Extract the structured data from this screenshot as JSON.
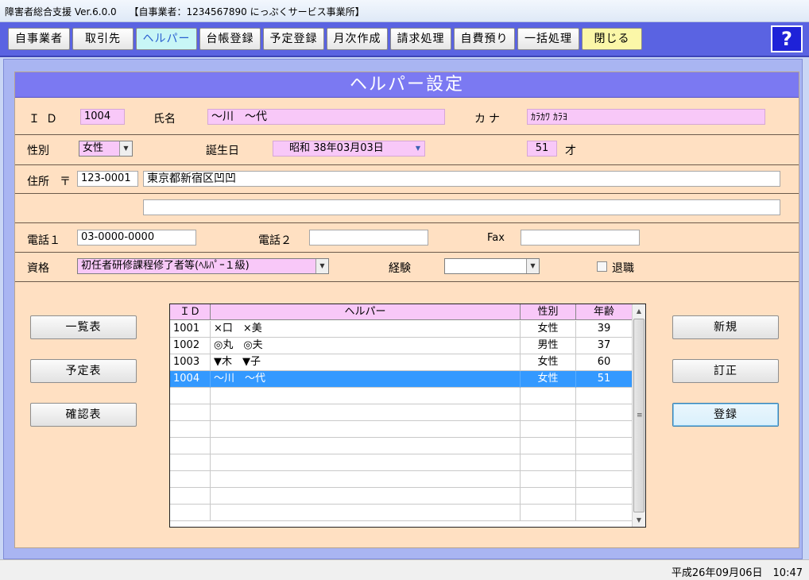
{
  "window": {
    "title": "障害者総合支援 Ver.6.0.0　 【自事業者：1234567890 にっぷくサービス事業所】"
  },
  "toolbar": {
    "items": [
      "自事業者",
      "取引先",
      "ヘルパー",
      "台帳登録",
      "予定登録",
      "月次作成",
      "請求処理",
      "自費預り",
      "一括処理",
      "閉じる"
    ],
    "active": "ヘルパー",
    "help_label": "?"
  },
  "form": {
    "title": "ヘルパー設定",
    "id_label": "ＩＤ",
    "id_value": "1004",
    "name_label": "氏名",
    "name_value": "～川　～代",
    "kana_label": "カナ",
    "kana_value": "ｶﾗｶﾜ ｶﾗﾖ",
    "gender_label": "性別",
    "gender_value": "女性",
    "birth_label": "誕生日",
    "birth_value": "昭和 38年03月03日",
    "age_value": "51",
    "age_unit": "才",
    "address_label": "住所",
    "postal_mark": "〒",
    "postal_value": "123-0001",
    "address1_value": "東京都新宿区凹凹",
    "address2_value": "",
    "phone1_label": "電話１",
    "phone1_value": "03-0000-0000",
    "phone2_label": "電話２",
    "phone2_value": "",
    "fax_label": "Fax",
    "fax_value": "",
    "qualification_label": "資格",
    "qualification_value": "初任者研修課程修了者等(ﾍﾙﾊﾟｰ１級)",
    "experience_label": "経験",
    "experience_value": "",
    "retired_label": "退職"
  },
  "left_buttons": {
    "list": "一覧表",
    "schedule": "予定表",
    "confirm": "確認表"
  },
  "right_buttons": {
    "new": "新規",
    "edit": "訂正",
    "register": "登録"
  },
  "grid": {
    "headers": {
      "id": "ＩＤ",
      "name": "ヘルパー",
      "gender": "性別",
      "age": "年齢"
    },
    "rows": [
      {
        "id": "1001",
        "name": "×口　×美",
        "gender": "女性",
        "age": "39"
      },
      {
        "id": "1002",
        "name": "◎丸　◎夫",
        "gender": "男性",
        "age": "37"
      },
      {
        "id": "1003",
        "name": "▼木　▼子",
        "gender": "女性",
        "age": "60"
      },
      {
        "id": "1004",
        "name": "～川　～代",
        "gender": "女性",
        "age": "51"
      }
    ],
    "selected_id": "1004"
  },
  "status": {
    "datetime": "平成26年09月06日　10:47"
  }
}
